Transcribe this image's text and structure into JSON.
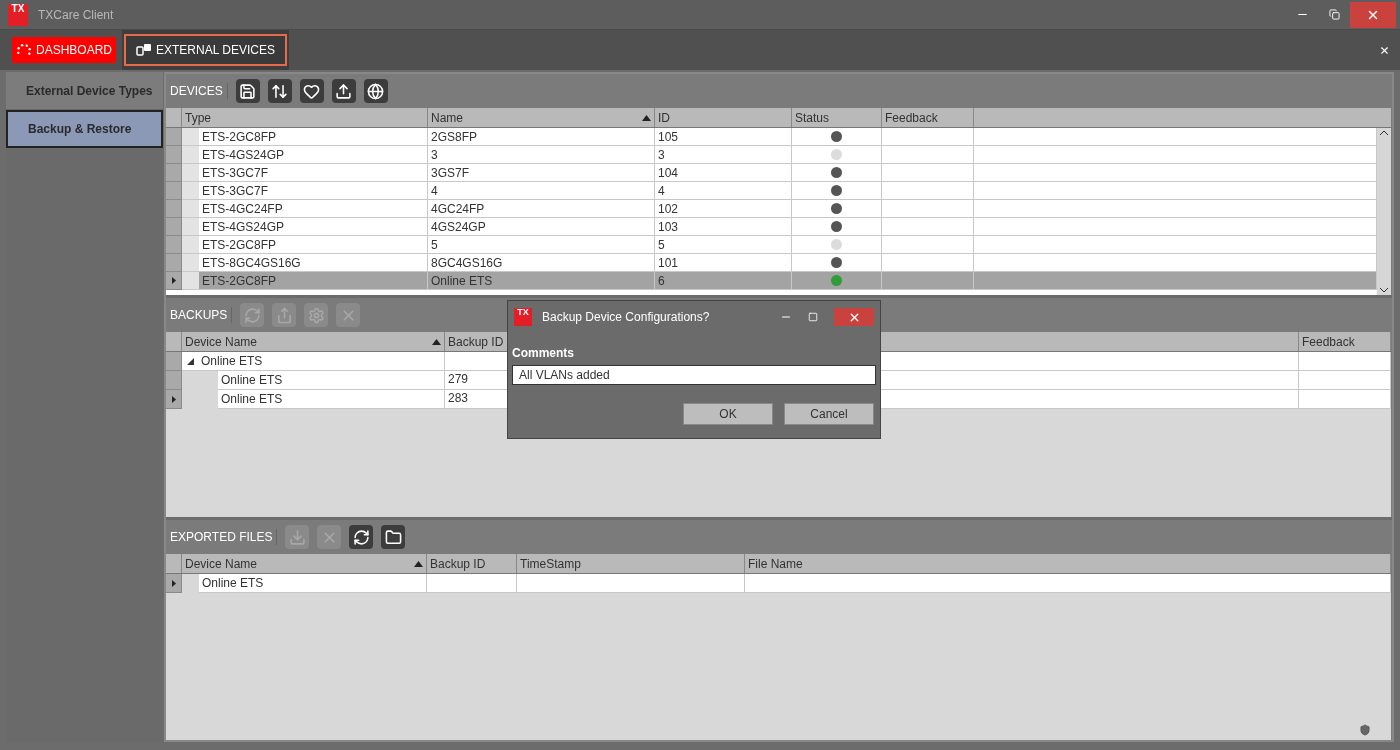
{
  "window": {
    "logo": "TX",
    "title": "TXCare Client"
  },
  "tabs": [
    {
      "label": "DASHBOARD",
      "kind": "dashboard",
      "selected": false
    },
    {
      "label": "EXTERNAL DEVICES",
      "kind": "devices",
      "selected": true
    }
  ],
  "sidebar": {
    "items": [
      {
        "label": "External Device Types",
        "selected": false
      },
      {
        "label": "Backup & Restore",
        "selected": true
      }
    ]
  },
  "devices": {
    "label": "DEVICES",
    "tools": [
      {
        "kind": "save",
        "disabled": false
      },
      {
        "kind": "expand",
        "disabled": false
      },
      {
        "kind": "heart",
        "disabled": false
      },
      {
        "kind": "upload",
        "disabled": false
      },
      {
        "kind": "globe",
        "disabled": false
      }
    ],
    "columns": [
      {
        "label": "Type",
        "sorted": false
      },
      {
        "label": "Name",
        "sorted": true
      },
      {
        "label": "ID",
        "sorted": false
      },
      {
        "label": "Status",
        "sorted": false
      },
      {
        "label": "Feedback",
        "sorted": false
      }
    ],
    "rows": [
      {
        "type": "ETS-2GC8FP",
        "name": "2GS8FP",
        "id": "105",
        "color": "#555555",
        "selected": false
      },
      {
        "type": "ETS-4GS24GP",
        "name": "3",
        "id": "3",
        "color": "#dcdcdc",
        "selected": false
      },
      {
        "type": "ETS-3GC7F",
        "name": "3GS7F",
        "id": "104",
        "color": "#555555",
        "selected": false
      },
      {
        "type": "ETS-3GC7F",
        "name": "4",
        "id": "4",
        "color": "#555555",
        "selected": false
      },
      {
        "type": "ETS-4GC24FP",
        "name": "4GC24FP",
        "id": "102",
        "color": "#555555",
        "selected": false
      },
      {
        "type": "ETS-4GS24GP",
        "name": "4GS24GP",
        "id": "103",
        "color": "#555555",
        "selected": false
      },
      {
        "type": "ETS-2GC8FP",
        "name": "5",
        "id": "5",
        "color": "#dcdcdc",
        "selected": false
      },
      {
        "type": "ETS-8GC4GS16G",
        "name": "8GC4GS16G",
        "id": "101",
        "color": "#555555",
        "selected": false
      },
      {
        "type": "ETS-2GC8FP",
        "name": "Online ETS",
        "id": "6",
        "color": "#2f9e3a",
        "selected": true
      }
    ]
  },
  "backups": {
    "label": "BACKUPS",
    "tools": [
      {
        "kind": "refresh",
        "disabled": true
      },
      {
        "kind": "export",
        "disabled": true
      },
      {
        "kind": "settings",
        "disabled": true
      },
      {
        "kind": "delete",
        "disabled": true
      }
    ],
    "columns": [
      {
        "label": "Device Name",
        "sorted": true
      },
      {
        "label": "Backup ID",
        "sorted": false
      },
      {
        "label": "Feedback",
        "sorted": false
      }
    ],
    "rows": [
      {
        "device_name": "Online ETS",
        "expanded": true,
        "selected": false,
        "children": [
          {
            "device_name": "Online ETS",
            "backup_id": "279",
            "selected": false
          },
          {
            "device_name": "Online ETS",
            "backup_id": "283",
            "selected": true
          }
        ]
      }
    ]
  },
  "exported_files": {
    "label": "EXPORTED FILES",
    "tools": [
      {
        "kind": "download",
        "disabled": true
      },
      {
        "kind": "delete",
        "disabled": true
      },
      {
        "kind": "refresh",
        "disabled": false
      },
      {
        "kind": "folder",
        "disabled": false
      }
    ],
    "columns": [
      {
        "label": "Device Name",
        "sorted": true
      },
      {
        "label": "Backup ID",
        "sorted": false
      },
      {
        "label": "TimeStamp",
        "sorted": false
      },
      {
        "label": "File Name",
        "sorted": false
      }
    ],
    "rows": [
      {
        "device_name": "Online ETS",
        "selected": true
      }
    ]
  },
  "dialog": {
    "logo": "TX",
    "title": "Backup Device Configurations?",
    "field_label": "Comments",
    "comment": "All VLANs added",
    "buttons": [
      "OK",
      "Cancel"
    ]
  }
}
